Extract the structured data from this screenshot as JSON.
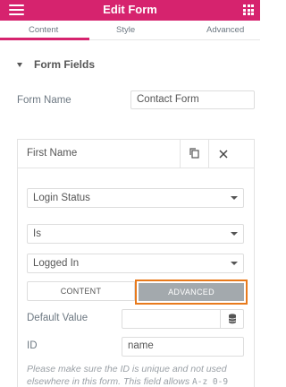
{
  "header": {
    "title": "Edit Form"
  },
  "tabs": [
    {
      "label": "Content",
      "active": true
    },
    {
      "label": "Style",
      "active": false
    },
    {
      "label": "Advanced",
      "active": false
    }
  ],
  "section": {
    "title": "Form Fields"
  },
  "form_name": {
    "label": "Form Name",
    "value": "Contact Form"
  },
  "field_item": {
    "title": "First Name",
    "condition_field": "Login Status",
    "condition_operator": "Is",
    "condition_value": "Logged In",
    "toggle": {
      "left": "CONTENT",
      "right": "ADVANCED",
      "selected": "ADVANCED"
    },
    "default_value": {
      "label": "Default Value",
      "value": ""
    },
    "id_field": {
      "label": "ID",
      "value": "name"
    },
    "help_text": "Please make sure the ID is unique and not used elsewhere in this form. This field allows",
    "help_code": "A-z 0-9"
  },
  "colors": {
    "brand": "#d6236e",
    "highlight": "#e87a1c",
    "toggle_active": "#a3a9ad"
  },
  "icons": [
    "hamburger-icon",
    "grid-icon",
    "caret-down-icon",
    "duplicate-icon",
    "close-icon",
    "select-arrow-icon",
    "database-icon"
  ]
}
